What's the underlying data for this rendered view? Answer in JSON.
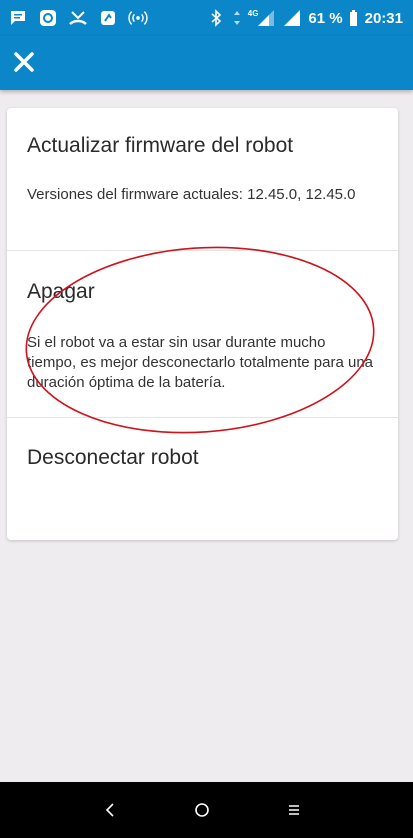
{
  "status_bar": {
    "icons": [
      "message-icon",
      "app-icon",
      "missed-call-icon",
      "app-icon",
      "hotspot-icon",
      "bluetooth-icon",
      "data-arrows-icon",
      "signal-icon",
      "signal-icon",
      "battery-icon"
    ],
    "network": "4G",
    "battery": "61 %",
    "time": "20:31"
  },
  "app_bar": {
    "close_icon": "close-icon"
  },
  "card": {
    "firmware": {
      "title": "Actualizar firmware del robot",
      "text": "Versiones del firmware actuales: 12.45.0, 12.45.0"
    },
    "shutdown": {
      "title": "Apagar",
      "text": "Si el robot va a estar sin usar durante mucho tiempo, es mejor desconectarlo totalmente para una duración óptima de la batería."
    },
    "disconnect": {
      "title": "Desconectar robot"
    }
  },
  "annotation": {
    "color": "#d0121b"
  },
  "colors": {
    "accent": "#0a86c9",
    "background": "#efecef"
  },
  "nav_bar": {
    "icons": [
      "back-icon",
      "home-icon",
      "recents-icon"
    ]
  }
}
